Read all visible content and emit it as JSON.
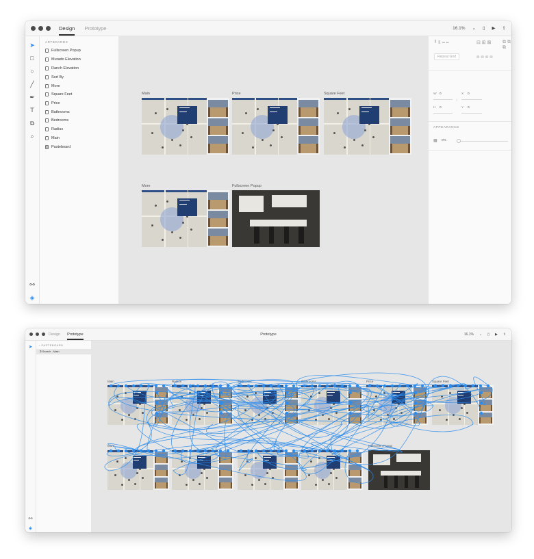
{
  "colors": {
    "accent": "#2d8ceb",
    "wire": "#2d8ceb",
    "canvas": "#e6e6e6",
    "popup": "#213e72"
  },
  "design_window": {
    "tabs": {
      "design": "Design",
      "prototype": "Prototype"
    },
    "zoom": "16.1%",
    "icons": [
      "phone-icon",
      "play-icon",
      "share-icon"
    ],
    "tools": [
      "select-icon",
      "rectangle-icon",
      "ellipse-icon",
      "line-icon",
      "pen-icon",
      "text-icon",
      "artboard-icon",
      "zoom-icon",
      "symbols-icon",
      "layers-icon"
    ],
    "layers_header": "ARTBOARDS",
    "layers": [
      "Fullscreen Popup",
      "Murado Elevation",
      "Ranch Elevation",
      "Sort By",
      "More",
      "Square Feet",
      "Price",
      "Bathrooms",
      "Bedrooms",
      "Radius",
      "Main",
      "Pasteboard"
    ],
    "props": {
      "repeat_grid": "Repeat Grid",
      "w_label": "W",
      "w_value": "0",
      "h_label": "H",
      "h_value": "0",
      "x_label": "X",
      "x_value": "0",
      "y_label": "Y",
      "y_value": "0",
      "appearance": "APPEARANCE",
      "opacity": "0%"
    },
    "artboards": {
      "main": "Main",
      "price": "Price",
      "square_feet": "Square Feet",
      "more": "More",
      "fullscreen": "Fullscreen Popup"
    }
  },
  "prototype_window": {
    "tabs": {
      "design": "Design",
      "prototype": "Prototype"
    },
    "title": "Prototype",
    "zoom": "16.1%",
    "layers_header": "PASTEBOARD",
    "selected_item": "Search - Main",
    "artboards": {
      "main": "Main",
      "radius": "Radius",
      "bedrooms": "Bedrooms",
      "bathrooms": "Bathrooms",
      "price": "Price",
      "square_feet": "Square Feet",
      "more": "More",
      "fullscreen": "Fullscreen Popup"
    }
  }
}
